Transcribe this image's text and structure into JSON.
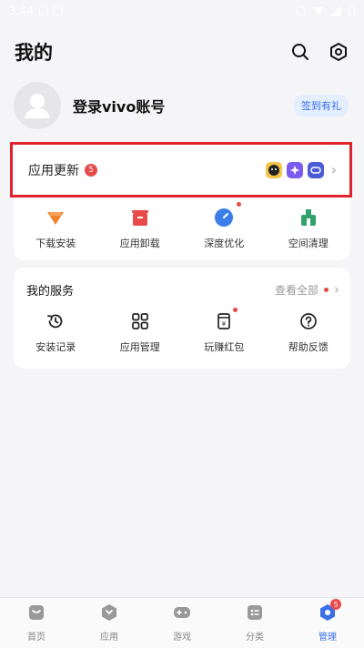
{
  "status_bar": {
    "time": "3:44"
  },
  "header": {
    "title": "我的"
  },
  "profile": {
    "login_text": "登录vivo账号",
    "checkin_label": "签到有礼"
  },
  "update": {
    "label": "应用更新",
    "count": "5"
  },
  "quick_actions": [
    {
      "label": "下载安装",
      "icon": "download-icon",
      "color": "#f0842c"
    },
    {
      "label": "应用卸载",
      "icon": "uninstall-icon",
      "color": "#e84a4a"
    },
    {
      "label": "深度优化",
      "icon": "optimize-icon",
      "color": "#3a7fe8"
    },
    {
      "label": "空间清理",
      "icon": "clean-icon",
      "color": "#2fa36b"
    }
  ],
  "services": {
    "title": "我的服务",
    "view_all": "查看全部",
    "items": [
      {
        "label": "安装记录",
        "icon": "history-icon"
      },
      {
        "label": "应用管理",
        "icon": "grid-icon"
      },
      {
        "label": "玩赚红包",
        "icon": "red-packet-icon"
      },
      {
        "label": "帮助反馈",
        "icon": "help-icon"
      }
    ]
  },
  "bottom_nav": [
    {
      "label": "首页",
      "icon": "home-icon"
    },
    {
      "label": "应用",
      "icon": "apps-icon"
    },
    {
      "label": "游戏",
      "icon": "gamepad-icon"
    },
    {
      "label": "分类",
      "icon": "category-icon"
    },
    {
      "label": "管理",
      "icon": "manage-icon",
      "badge": "5",
      "active": true
    }
  ],
  "colors": {
    "accent": "#3a6fe8",
    "highlight_border": "#e0232e",
    "badge": "#e84a4a"
  }
}
